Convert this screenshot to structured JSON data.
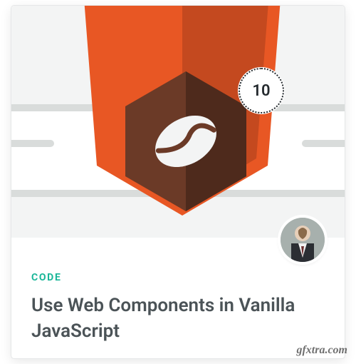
{
  "card": {
    "category_label": "CODE",
    "title": "Use Web Components in Vanilla JavaScript",
    "lesson_count": "10",
    "accent_color": "#19b698",
    "shield_color": "#e85724",
    "shield_shadow": "#c4491f",
    "hex_color": "#6b3a27",
    "hex_shadow": "#4e2a1c",
    "bean_color": "#f3f4f4"
  },
  "icons": {
    "shield": "shield-icon",
    "hexagon": "hexagon-icon",
    "coffee_bean": "coffee-bean-icon",
    "lesson_badge": "lesson-count-badge",
    "avatar": "instructor-avatar"
  },
  "watermark": "gfxtra.com"
}
